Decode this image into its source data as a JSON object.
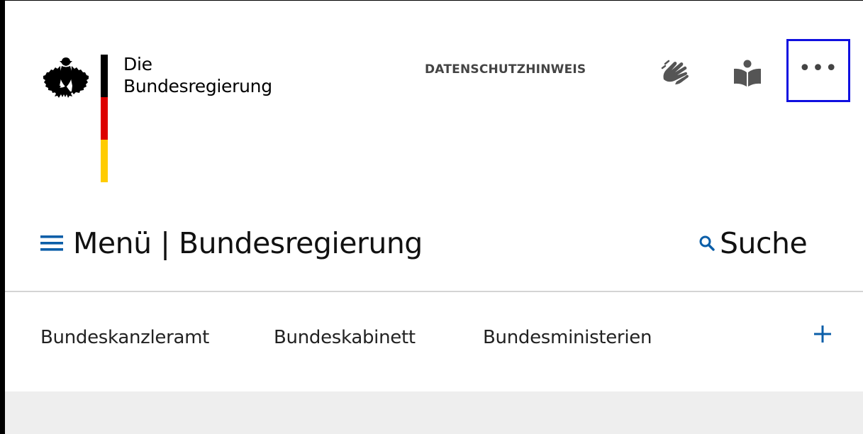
{
  "header": {
    "logo_line1": "Die",
    "logo_line2": "Bundesregierung",
    "privacy_label": "DATENSCHUTZHINWEIS",
    "tools": {
      "sign_language_icon": "sign-language-icon",
      "easy_language_icon": "easy-language-icon",
      "more_label": "•••"
    },
    "flag_colors": [
      "#000000",
      "#dd0000",
      "#ffcc00"
    ]
  },
  "nav": {
    "menu_label": "Menü | Bundesregierung",
    "search_label": "Suche",
    "accent_color": "#0b5ea8"
  },
  "subnav": {
    "items": [
      {
        "label": "Bundeskanzleramt"
      },
      {
        "label": "Bundeskabinett"
      },
      {
        "label": "Bundesministerien"
      }
    ],
    "expand_icon": "plus-icon"
  }
}
